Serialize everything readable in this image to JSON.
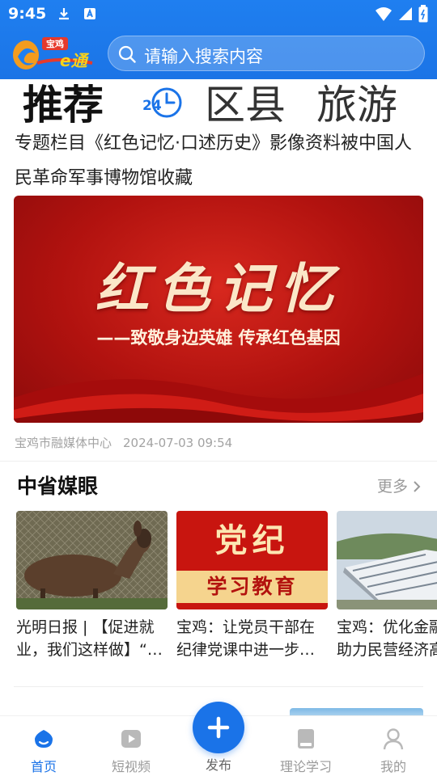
{
  "status_bar": {
    "time": "9:45"
  },
  "header": {
    "logo_text": "宝鸡一e通",
    "search_placeholder": "请输入搜索内容"
  },
  "category_tabs": [
    {
      "label": "推荐",
      "active": true
    },
    {
      "label": "宝鸡24hours",
      "icon": "clock-24-icon"
    },
    {
      "label": "区县"
    },
    {
      "label": "旅游"
    }
  ],
  "headline": {
    "title": "专题栏目《红色记忆·口述历史》影像资料被中国人民革命军事博物馆收藏",
    "image_title": "红色记忆",
    "image_subtitle": "——致敬身边英雄 传承红色基因",
    "source": "宝鸡市融媒体中心",
    "time": "2024-07-03 09:54"
  },
  "section": {
    "title": "中省媒眼",
    "more_label": "更多"
  },
  "cards": [
    {
      "caption": "光明日报 | 【促进就业，我们这样做】“…",
      "image": "deer-photo"
    },
    {
      "caption": "宝鸡：让党员干部在纪律党课中进一步…",
      "image_text_top": "党纪",
      "image_text_bottom": "学习教育"
    },
    {
      "caption": "宝鸡：优化金融环境助力民营经济高质量发展",
      "image": "factory-aerial-photo"
    }
  ],
  "bottom_nav": [
    {
      "label": "首页",
      "icon": "home-icon",
      "active": true
    },
    {
      "label": "短视频",
      "icon": "video-icon"
    },
    {
      "label": "发布",
      "icon": "plus-icon"
    },
    {
      "label": "理论学习",
      "icon": "book-icon"
    },
    {
      "label": "我的",
      "icon": "user-icon"
    }
  ],
  "colors": {
    "brand_blue": "#1a73e8",
    "header_blue": "#1f7ff0",
    "hero_red": "#c41a14",
    "muted_gray": "#9a9a9a"
  }
}
